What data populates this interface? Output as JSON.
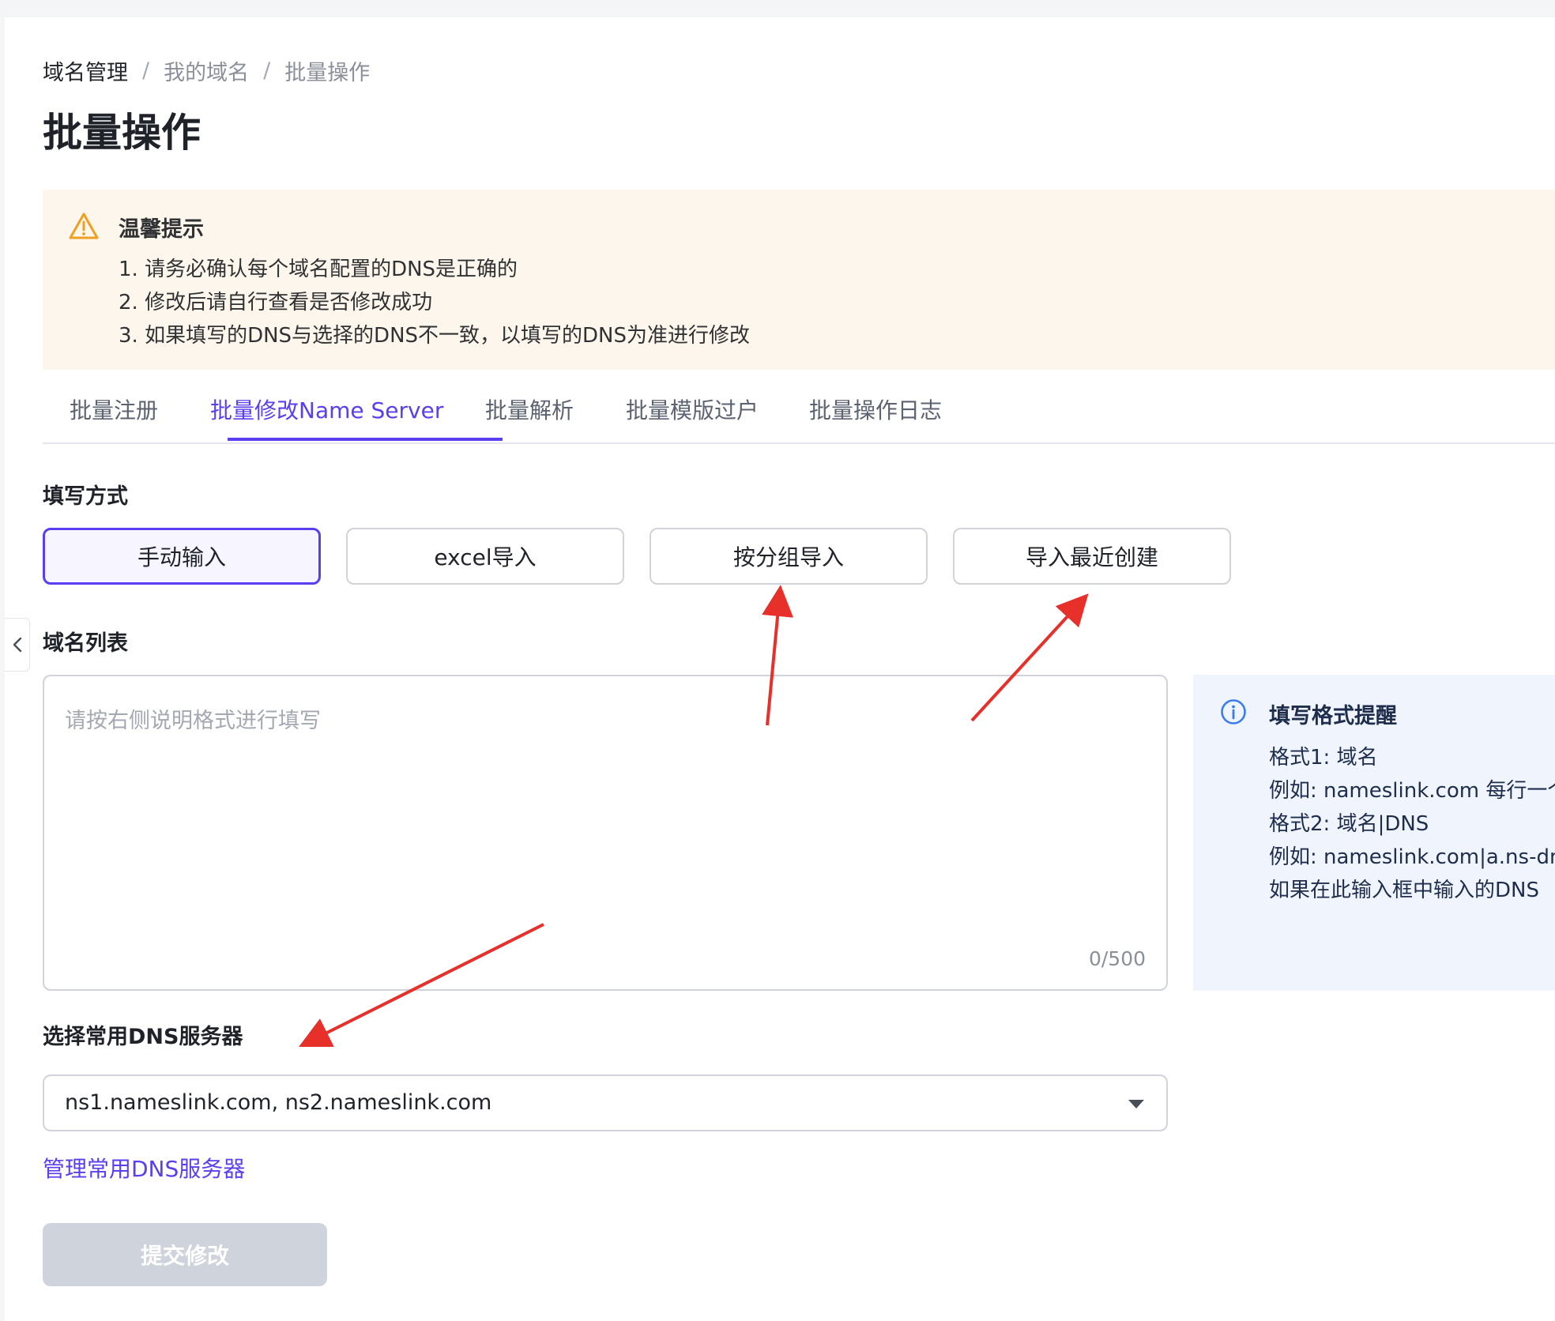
{
  "breadcrumb": {
    "items": [
      "域名管理",
      "我的域名",
      "批量操作"
    ],
    "separator": "/"
  },
  "page_title": "批量操作",
  "notice": {
    "title": "温馨提示",
    "lines": [
      "1. 请务必确认每个域名配置的DNS是正确的",
      "2. 修改后请自行查看是否修改成功",
      "3. 如果填写的DNS与选择的DNS不一致，以填写的DNS为准进行修改"
    ],
    "icon": "warning-icon",
    "color": "#f0a020"
  },
  "tabs": [
    {
      "label": "批量注册",
      "active": false
    },
    {
      "label": "批量修改Name Server",
      "active": true
    },
    {
      "label": "批量解析",
      "active": false
    },
    {
      "label": "批量模版过户",
      "active": false
    },
    {
      "label": "批量操作日志",
      "active": false
    }
  ],
  "fill_method": {
    "label": "填写方式",
    "options": [
      {
        "label": "手动输入",
        "selected": true
      },
      {
        "label": "excel导入",
        "selected": false
      },
      {
        "label": "按分组导入",
        "selected": false
      },
      {
        "label": "导入最近创建",
        "selected": false
      }
    ]
  },
  "domain_list": {
    "label": "域名列表",
    "placeholder": "请按右侧说明格式进行填写",
    "value": "",
    "counter": "0/500"
  },
  "format_hint": {
    "title": "填写格式提醒",
    "lines": [
      "格式1: 域名",
      "例如: nameslink.com 每行一个",
      "格式2: 域名|DNS",
      "例如: nameslink.com|a.ns-dns",
      "如果在此输入框中输入的DNS"
    ],
    "icon": "info-icon"
  },
  "dns_select": {
    "label": "选择常用DNS服务器",
    "value": "ns1.nameslink.com, ns2.nameslink.com"
  },
  "manage_dns_link": "管理常用DNS服务器",
  "submit_button": {
    "label": "提交修改",
    "disabled": true
  },
  "colors": {
    "accent": "#5a3ff0",
    "annotation_arrow": "#e8302a",
    "notice_bg": "#fdf6ec",
    "hint_bg": "#f0f5fd",
    "disabled_button": "#ced3dc"
  }
}
